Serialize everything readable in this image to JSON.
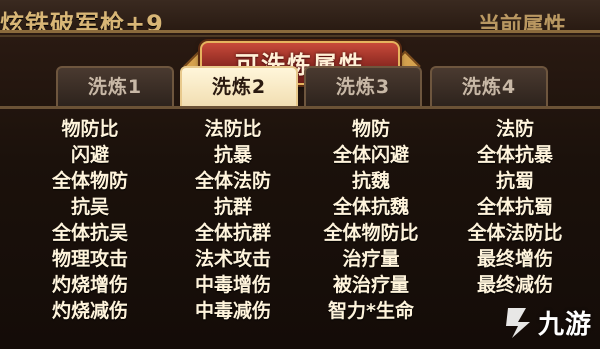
{
  "background": {
    "left_text": "炫铁破军枪+9",
    "right_text": "当前属性"
  },
  "panel": {
    "title": "可洗炼属性"
  },
  "tabs": [
    {
      "label": "洗炼1",
      "active": false
    },
    {
      "label": "洗炼2",
      "active": true
    },
    {
      "label": "洗炼3",
      "active": false
    },
    {
      "label": "洗炼4",
      "active": false
    }
  ],
  "columns": [
    [
      "物防比",
      "闪避",
      "全体物防",
      "抗吴",
      "全体抗吴",
      "物理攻击",
      "灼烧增伤",
      "灼烧减伤"
    ],
    [
      "法防比",
      "抗暴",
      "全体法防",
      "抗群",
      "全体抗群",
      "法术攻击",
      "中毒增伤",
      "中毒减伤"
    ],
    [
      "物防",
      "全体闪避",
      "抗魏",
      "全体抗魏",
      "全体物防比",
      "治疗量",
      "被治疗量",
      "智力*生命"
    ],
    [
      "法防",
      "全体抗暴",
      "抗蜀",
      "全体抗蜀",
      "全体法防比",
      "最终增伤",
      "最终减伤",
      ""
    ]
  ],
  "watermark": {
    "text": "九游",
    "icon": "nine-game-logo-icon"
  },
  "colors": {
    "title_plate": "#8e2a22",
    "active_tab": "#f1ddb0",
    "attr_text": "#fff4dc"
  }
}
